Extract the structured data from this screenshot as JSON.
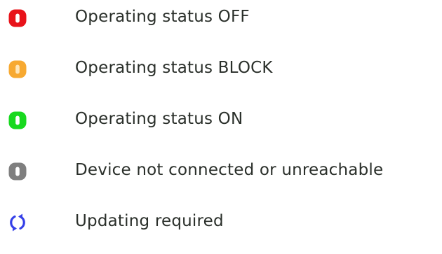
{
  "legend": {
    "items": [
      {
        "icon": "status-off-icon",
        "color": "#e8131a",
        "label": "Operating status OFF"
      },
      {
        "icon": "status-block-icon",
        "color": "#f7a931",
        "label": "Operating status BLOCK"
      },
      {
        "icon": "status-on-icon",
        "color": "#18d91f",
        "label": "Operating status ON"
      },
      {
        "icon": "status-unreachable-icon",
        "color": "#7f7f7f",
        "label": "Device not connected or unreachable"
      },
      {
        "icon": "refresh-icon",
        "color": "#3540e8",
        "label": "Updating required"
      }
    ]
  }
}
